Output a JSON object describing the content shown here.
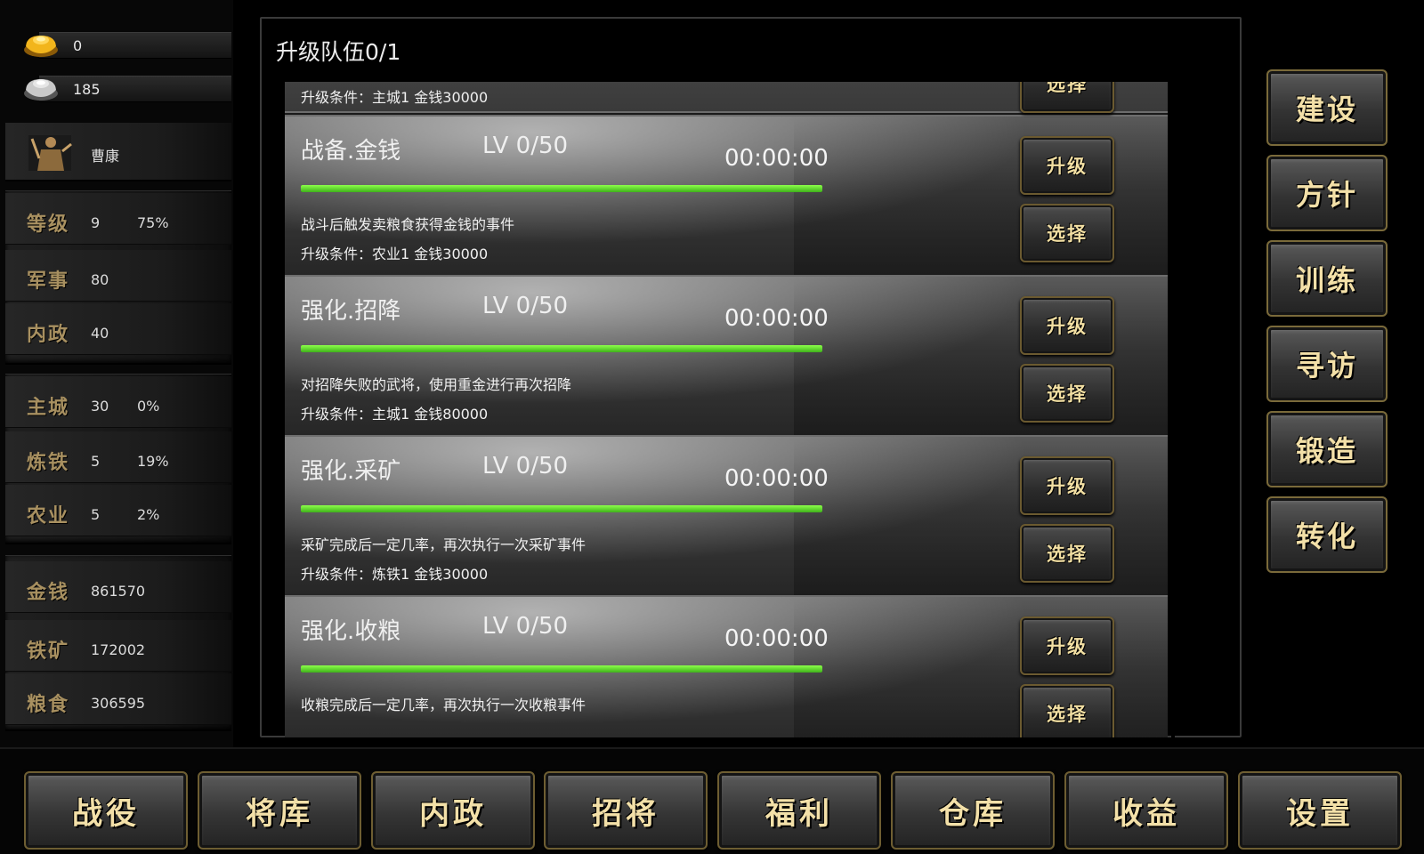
{
  "resources": {
    "gold_ingots": "0",
    "silver_ingots": "185"
  },
  "hero": {
    "name": "曹康"
  },
  "stats": {
    "level": {
      "label": "等级",
      "value": "9",
      "percent": "75%"
    },
    "military": {
      "label": "军事",
      "value": "80"
    },
    "politics": {
      "label": "内政",
      "value": "40"
    },
    "main_city": {
      "label": "主城",
      "value": "30",
      "percent": "0%"
    },
    "smelting": {
      "label": "炼铁",
      "value": "5",
      "percent": "19%"
    },
    "farming": {
      "label": "农业",
      "value": "5",
      "percent": "2%"
    },
    "money": {
      "label": "金钱",
      "value": "861570"
    },
    "iron_ore": {
      "label": "铁矿",
      "value": "172002"
    },
    "grain": {
      "label": "粮食",
      "value": "306595"
    }
  },
  "panel": {
    "title": "升级队伍0/1",
    "partial_condition": "升级条件：主城1 金钱30000",
    "upgrade_label": "升级",
    "select_label": "选择",
    "cards": [
      {
        "name": "战备.金钱",
        "lv": "LV 0/50",
        "time": "00:00:00",
        "progress": 1.0,
        "desc": "战斗后触发卖粮食获得金钱的事件",
        "cond": "升级条件：农业1 金钱30000"
      },
      {
        "name": "强化.招降",
        "lv": "LV 0/50",
        "time": "00:00:00",
        "progress": 1.0,
        "desc": "对招降失败的武将，使用重金进行再次招降",
        "cond": "升级条件：主城1 金钱80000"
      },
      {
        "name": "强化.采矿",
        "lv": "LV 0/50",
        "time": "00:00:00",
        "progress": 1.0,
        "desc": "采矿完成后一定几率，再次执行一次采矿事件",
        "cond": "升级条件：炼铁1 金钱30000"
      },
      {
        "name": "强化.收粮",
        "lv": "LV 0/50",
        "time": "00:00:00",
        "progress": 1.0,
        "desc": "收粮完成后一定几率，再次执行一次收粮事件",
        "cond": ""
      }
    ]
  },
  "side_buttons": [
    "建设",
    "方针",
    "训练",
    "寻访",
    "锻造",
    "转化"
  ],
  "bottom_nav": [
    "战役",
    "将库",
    "内政",
    "招将",
    "福利",
    "仓库",
    "收益",
    "设置"
  ],
  "colors": {
    "progress": "#5fd12f",
    "label_gold": "#a89060",
    "button_text": "#f3e0a8"
  },
  "icons": {
    "gold": "gold-ingot-icon",
    "silver": "silver-ingot-icon",
    "hero": "warrior-icon"
  }
}
